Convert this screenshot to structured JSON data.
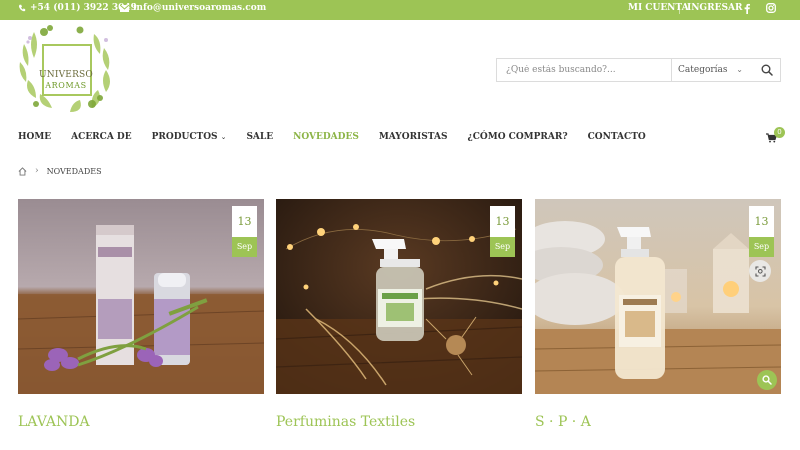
{
  "topbar": {
    "phone": "+54 (011) 3922 3049",
    "email": "info@universoaromas.com",
    "account": "MI CUENTA",
    "login": "INGRESAR",
    "icons": {
      "phone": "phone-icon",
      "email": "envelope-icon",
      "facebook": "facebook-icon",
      "instagram": "instagram-icon"
    }
  },
  "logo": {
    "line1": "UNIVERSO",
    "line2": "AROMAS"
  },
  "search": {
    "placeholder": "¿Qué estás buscando?...",
    "category": "Categorías",
    "button_icon": "search-icon"
  },
  "nav": {
    "items": [
      {
        "label": "HOME"
      },
      {
        "label": "ACERCA DE"
      },
      {
        "label": "PRODUCTOS",
        "has_dropdown": true
      },
      {
        "label": "SALE"
      },
      {
        "label": "NOVEDADES",
        "active": true
      },
      {
        "label": "MAYORISTAS"
      },
      {
        "label": "¿CÓMO COMPRAR?"
      },
      {
        "label": "CONTACTO"
      }
    ],
    "cart_count": "0"
  },
  "breadcrumb": {
    "home_icon": "home-icon",
    "current": "NOVEDADES"
  },
  "posts": [
    {
      "title": "LAVANDA",
      "day": "13",
      "month": "Sep"
    },
    {
      "title": "Perfuminas Textiles",
      "day": "13",
      "month": "Sep"
    },
    {
      "title": "S · P · A",
      "day": "13",
      "month": "Sep"
    }
  ],
  "colors": {
    "accent": "#9dc455",
    "accent_dark": "#8cb446",
    "text": "#333333"
  }
}
